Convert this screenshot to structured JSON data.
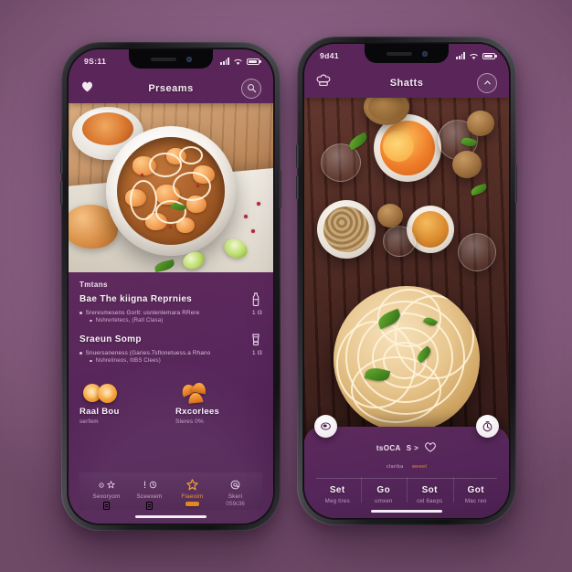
{
  "scene": {
    "background_color": "#8e6488",
    "accent_color": "#e2912c",
    "panel_color": "#57265a",
    "appbar_color": "#5a2659"
  },
  "left_phone": {
    "status": {
      "time": "9S:11",
      "signal_icon": "signal-bars-icon",
      "wifi_icon": "wifi-icon",
      "battery_icon": "battery-icon"
    },
    "appbar": {
      "back_icon": "heart-icon",
      "title": "Prseams",
      "action_icon": "search-icon"
    },
    "hero": {
      "image_alt": "white-bowl-of-pasta-and-chickpeas-on-wood-table"
    },
    "panel": {
      "section_label": "Tmtans",
      "entries": [
        {
          "title": "Bae The kiigna Reprnies",
          "icon": "bottle-icon",
          "bullet": "Sreresmesens Gorlt: usnlenlemara RRere",
          "qty": "1 l3",
          "subbullet": "Nshrerletecs, (Ratl Clasa)"
        },
        {
          "title": "Sraeun Somp",
          "icon": "blender-icon",
          "bullet": "Snuersaneness (Garies.Tsflonetuess.a Rhano",
          "qty": "1 l3",
          "subbullet": "Nshrelineos, ltlBS Clees)"
        }
      ],
      "tiles": [
        {
          "art": "orange-halves-icon",
          "title": "Raal Bou",
          "sub": "serfem"
        },
        {
          "art": "orange-wedges-icon",
          "title": "Rxcorlees",
          "sub": "Sleres 0%"
        }
      ]
    },
    "tabbar": [
      {
        "icon": "gear-flower-icon",
        "label": "Sexoryom",
        "sub_icon": "document-icon",
        "active": false
      },
      {
        "icon": "alert-clock-icon",
        "label": "Sceexem",
        "sub_icon": "document-icon",
        "active": false
      },
      {
        "icon": "star-icon",
        "label": "Flaeoim",
        "sub_icon": "pill-badge-icon",
        "active": true
      },
      {
        "icon": "at-circle-icon",
        "label": "Skeri",
        "sub_text": "0S9c36",
        "active": false
      }
    ]
  },
  "right_phone": {
    "status": {
      "time": "9d41",
      "signal_icon": "signal-bars-icon",
      "wifi_icon": "wifi-icon",
      "battery_icon": "battery-icon"
    },
    "appbar": {
      "back_icon": "chef-hat-icon",
      "title": "Shatts",
      "action_icon": "chevron-up-icon"
    },
    "hero": {
      "image_alt": "overhead-food-spread-with-spaghetti-bowl-on-dark-wood"
    },
    "sheet": {
      "left_fab_icon": "plate-icon",
      "right_fab_icon": "timer-icon",
      "mid_text": "tsOCA",
      "mid_sep": "S >",
      "mid_icon": "heart-tag-icon",
      "sub_left": "clariba",
      "sub_right": "weeel",
      "columns": [
        {
          "title": "Set",
          "sub": "Meg tires"
        },
        {
          "title": "Go",
          "sub": "umxen"
        },
        {
          "title": "Sot",
          "sub": "cel 6aeps"
        },
        {
          "title": "Got",
          "sub": "Mac reo"
        }
      ]
    }
  }
}
